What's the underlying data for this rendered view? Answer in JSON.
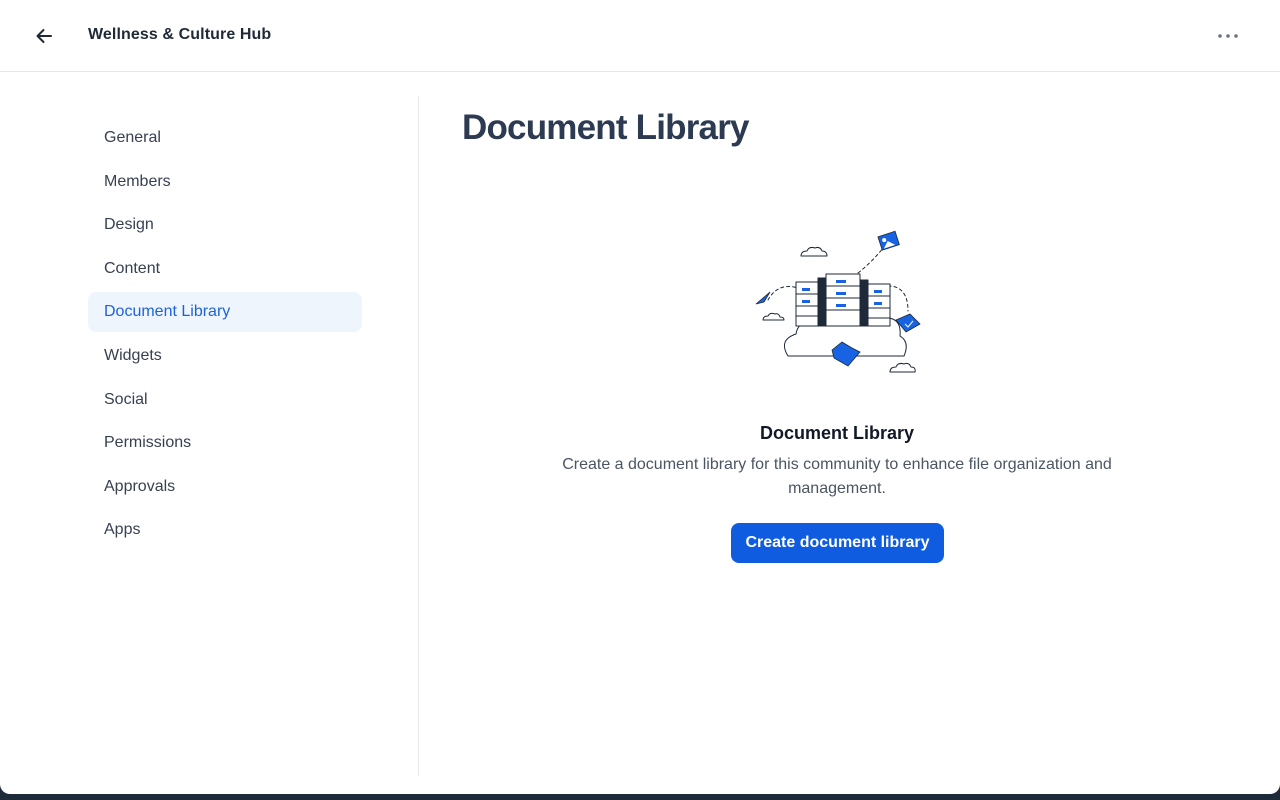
{
  "header": {
    "title": "Wellness & Culture Hub",
    "back_icon": "arrow-left-icon",
    "more_icon": "more-horizontal-icon"
  },
  "sidebar": {
    "items": [
      {
        "label": "General"
      },
      {
        "label": "Members"
      },
      {
        "label": "Design"
      },
      {
        "label": "Content"
      },
      {
        "label": "Document Library",
        "active": true
      },
      {
        "label": "Widgets"
      },
      {
        "label": "Social"
      },
      {
        "label": "Permissions"
      },
      {
        "label": "Approvals"
      },
      {
        "label": "Apps"
      }
    ]
  },
  "main": {
    "title": "Document Library",
    "empty_state": {
      "illustration": "file-cabinets-cloud-illustration",
      "title": "Document Library",
      "description": "Create a document library for this community to enhance file organization and management.",
      "button_label": "Create document library"
    }
  },
  "colors": {
    "accent": "#0f5ce0",
    "active_nav_bg": "#eff5fd",
    "active_nav_text": "#1d63d6"
  }
}
